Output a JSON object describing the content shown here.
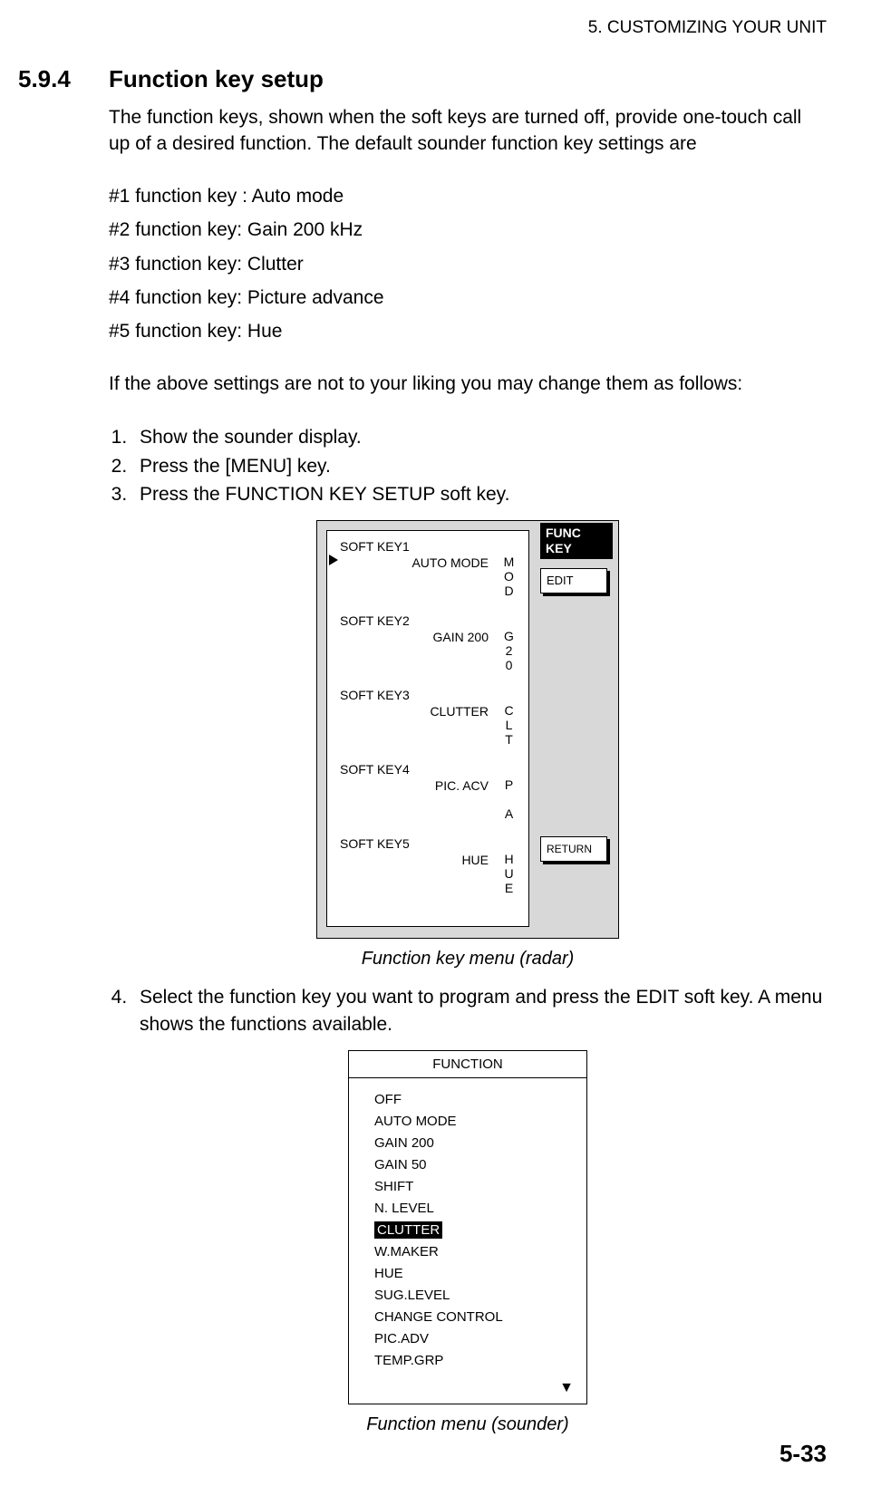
{
  "header": {
    "chapter": "5. CUSTOMIZING YOUR UNIT"
  },
  "section": {
    "number": "5.9.4",
    "title": "Function key setup"
  },
  "intro": "The function keys, shown when the soft keys are turned off, provide one-touch call up of a desired function. The default sounder function key settings are",
  "defaults": [
    "#1 function key : Auto mode",
    "#2 function key: Gain 200 kHz",
    "#3 function key: Clutter",
    "#4 function key: Picture advance",
    "#5 function key: Hue"
  ],
  "change_intro": "If the above settings are not to your liking you may change them as follows:",
  "steps": [
    "Show the sounder display.",
    "Press the [MENU] key.",
    "Press the FUNCTION KEY SETUP soft key."
  ],
  "step4": "Select the function key you want to program and press the EDIT soft key. A menu shows the functions available.",
  "fig1": {
    "right_title_l1": "FUNC",
    "right_title_l2": "KEY",
    "btn_edit": "EDIT",
    "btn_return": "RETURN",
    "softkeys": [
      {
        "name": "SOFT KEY1",
        "value": "AUTO MODE",
        "tag": "M\nO\nD",
        "selected": true
      },
      {
        "name": "SOFT KEY2",
        "value": "GAIN 200",
        "tag": "G\n2\n0",
        "selected": false
      },
      {
        "name": "SOFT KEY3",
        "value": "CLUTTER",
        "tag": "C\nL\nT",
        "selected": false
      },
      {
        "name": "SOFT KEY4",
        "value": "PIC. ACV",
        "tag": "P\n\nA",
        "selected": false
      },
      {
        "name": "SOFT KEY5",
        "value": "HUE",
        "tag": "H\nU\nE",
        "selected": false
      }
    ],
    "caption": "Function key menu (radar)"
  },
  "fig2": {
    "title": "FUNCTION",
    "items": [
      {
        "label": "OFF",
        "selected": false
      },
      {
        "label": "AUTO MODE",
        "selected": false
      },
      {
        "label": "GAIN 200",
        "selected": false
      },
      {
        "label": "GAIN   50",
        "selected": false
      },
      {
        "label": "SHIFT",
        "selected": false
      },
      {
        "label": "N. LEVEL",
        "selected": false
      },
      {
        "label": "CLUTTER",
        "selected": true
      },
      {
        "label": "W.MAKER",
        "selected": false
      },
      {
        "label": "HUE",
        "selected": false
      },
      {
        "label": "SUG.LEVEL",
        "selected": false
      },
      {
        "label": "CHANGE CONTROL",
        "selected": false
      },
      {
        "label": "PIC.ADV",
        "selected": false
      },
      {
        "label": "TEMP.GRP",
        "selected": false
      }
    ],
    "more": "▼",
    "caption": "Function menu (sounder)"
  },
  "page_number": "5-33"
}
